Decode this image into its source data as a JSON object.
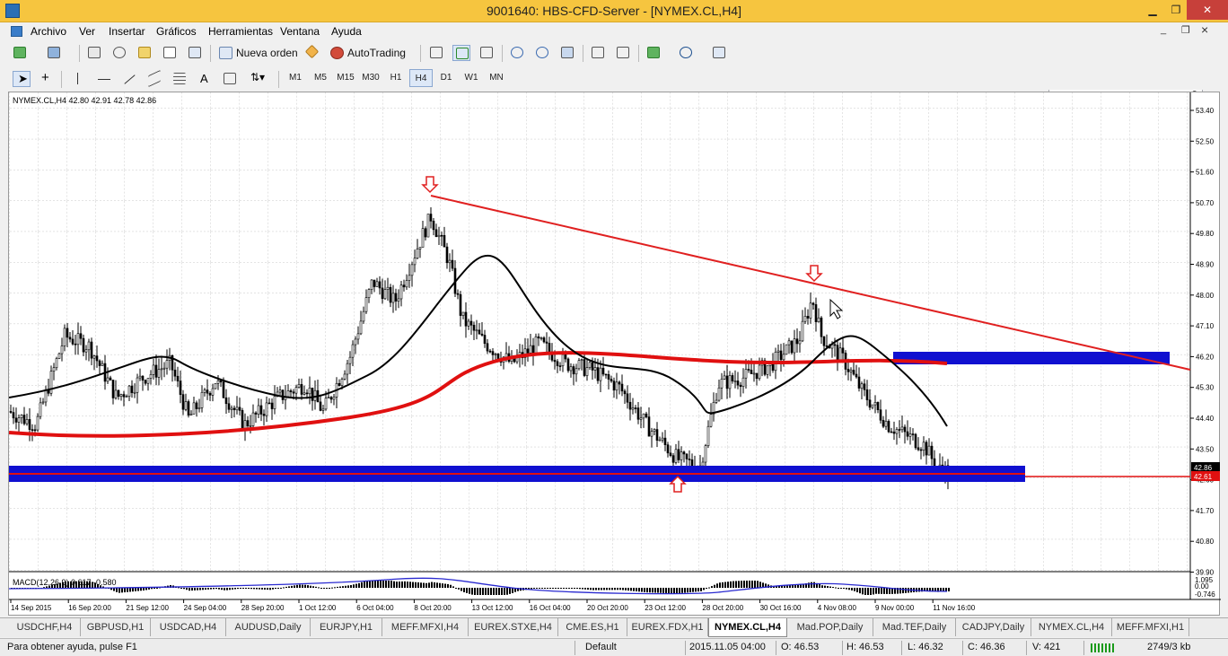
{
  "window": {
    "title": "9001640: HBS-CFD-Server - [NYMEX.CL,H4]",
    "minimize": "▁",
    "restore": "❐",
    "close": "✕",
    "mdi_min": "_",
    "mdi_restore": "❐",
    "mdi_close": "×"
  },
  "menu": [
    "Archivo",
    "Ver",
    "Insertar",
    "Gráficos",
    "Herramientas",
    "Ventana",
    "Ayuda"
  ],
  "toolbar": {
    "new_order": "Nueva orden",
    "autotrading": "AutoTrading",
    "text_tool": "A",
    "timeframes": [
      "M1",
      "M5",
      "M15",
      "M30",
      "H1",
      "H4",
      "D1",
      "W1",
      "MN"
    ],
    "active_timeframe": "H4"
  },
  "search": {
    "placeholder": "",
    "icon": "search-icon"
  },
  "chart": {
    "header": "NYMEX.CL,H4  42.80 42.91 42.78 42.86",
    "price_ticks": [
      "53.40",
      "52.50",
      "51.60",
      "50.70",
      "49.80",
      "48.90",
      "48.00",
      "47.10",
      "46.20",
      "45.30",
      "44.40",
      "43.50",
      "42.60",
      "41.70",
      "40.80",
      "39.90"
    ],
    "current_price": "42.86",
    "bid_line_price": "42.61",
    "time_ticks": [
      "14 Sep 2015",
      "16 Sep 20:00",
      "21 Sep 12:00",
      "24 Sep 04:00",
      "28 Sep 20:00",
      "1 Oct 12:00",
      "6 Oct 04:00",
      "8 Oct 20:00",
      "13 Oct 12:00",
      "16 Oct 04:00",
      "20 Oct 20:00",
      "23 Oct 12:00",
      "28 Oct 20:00",
      "30 Oct 16:00",
      "4 Nov 08:00",
      "9 Nov 00:00",
      "11 Nov 16:00"
    ],
    "macd_label": "MACD(12,26,9) 0.617 -0.580",
    "macd_ticks": [
      "1.095",
      "0.00",
      "-0.746"
    ],
    "colors": {
      "candles": "#000000",
      "ma_short": "#000000",
      "ma_long": "#e01010",
      "trendline": "#e02020",
      "zones": "#1010d0",
      "arrows": "#e02020"
    }
  },
  "tabs": [
    "USDCHF,H4",
    "GBPUSD,H1",
    "USDCAD,H4",
    "AUDUSD,Daily",
    "EURJPY,H1",
    "MEFF.MFXI,H4",
    "EUREX.STXE,H4",
    "CME.ES,H1",
    "EUREX.FDX,H1",
    "NYMEX.CL,H4",
    "Mad.POP,Daily",
    "Mad.TEF,Daily",
    "CADJPY,Daily",
    "NYMEX.CL,H4",
    "MEFF.MFXI,H1"
  ],
  "active_tab": 9,
  "status": {
    "help": "Para obtener ayuda, pulse F1",
    "profile": "Default",
    "datetime": "2015.11.05 04:00",
    "open": "O: 46.53",
    "high": "H: 46.53",
    "low": "L: 46.32",
    "close": "C: 46.36",
    "volume": "V: 421",
    "traffic": "2749/3 kb"
  }
}
